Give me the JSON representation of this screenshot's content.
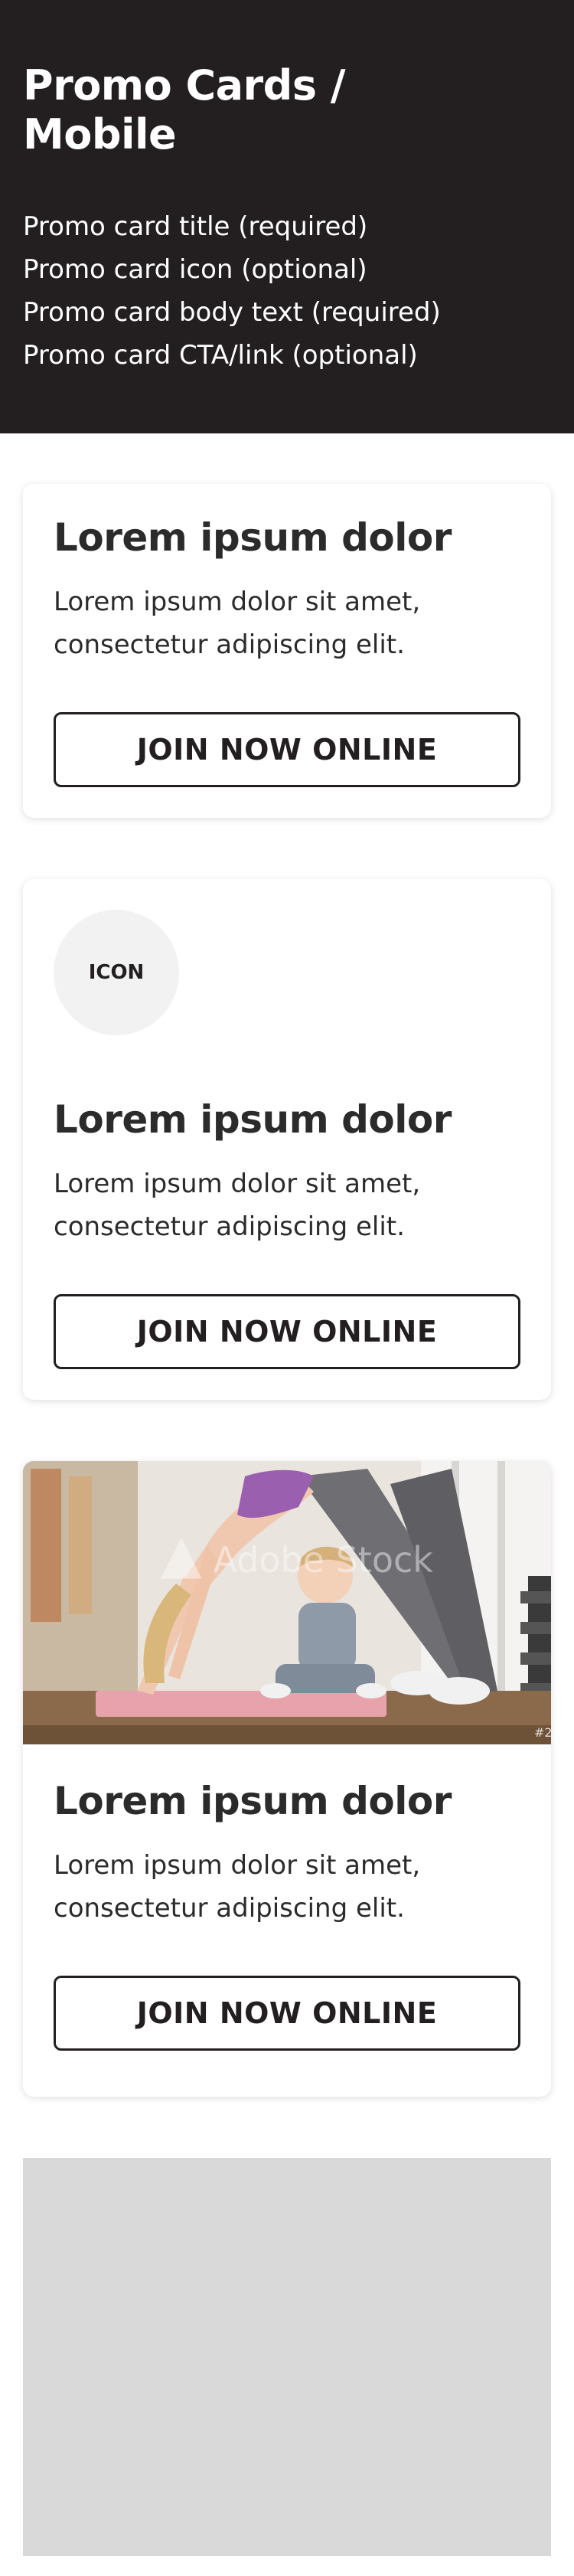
{
  "header": {
    "title": "Promo Cards / Mobile",
    "notes": [
      "Promo card title (required)",
      "Promo card icon (optional)",
      "Promo card body text (required)",
      "Promo card CTA/link (optional)"
    ]
  },
  "cards": [
    {
      "title": "Lorem ipsum dolor",
      "body": "Lorem ipsum dolor sit amet, consectetur adipiscing elit.",
      "cta": "JOIN NOW ONLINE"
    },
    {
      "icon_label": "ICON",
      "title": "Lorem ipsum dolor",
      "body": "Lorem ipsum dolor sit amet, consectetur adipiscing elit.",
      "cta": "JOIN NOW ONLINE"
    },
    {
      "image": {
        "alt": "Woman doing yoga downward dog pose with a child sitting on a mat",
        "watermark": "Adobe Stock",
        "watermark_id": "#2"
      },
      "title": "Lorem ipsum dolor",
      "body": "Lorem ipsum dolor sit amet, consectetur adipiscing elit.",
      "cta": "JOIN NOW ONLINE"
    }
  ],
  "colors": {
    "header_bg": "#231f20",
    "text": "#2b2b2b",
    "icon_bg": "#f2f2f2",
    "placeholder_bg": "#d9d9d9"
  }
}
